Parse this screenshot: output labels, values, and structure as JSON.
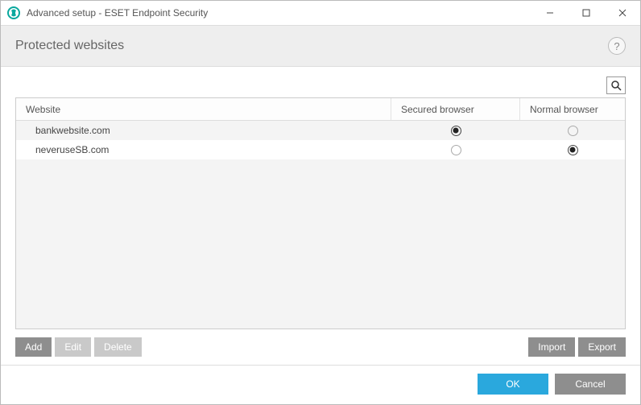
{
  "window": {
    "title": "Advanced setup - ESET Endpoint Security"
  },
  "header": {
    "title": "Protected websites"
  },
  "table": {
    "columns": {
      "website": "Website",
      "secured": "Secured browser",
      "normal": "Normal browser"
    },
    "rows": [
      {
        "website": "bankwebsite.com",
        "secured": true,
        "normal": false
      },
      {
        "website": "neveruseSB.com",
        "secured": false,
        "normal": true
      }
    ]
  },
  "buttons": {
    "add": "Add",
    "edit": "Edit",
    "delete": "Delete",
    "import": "Import",
    "export": "Export",
    "ok": "OK",
    "cancel": "Cancel"
  }
}
